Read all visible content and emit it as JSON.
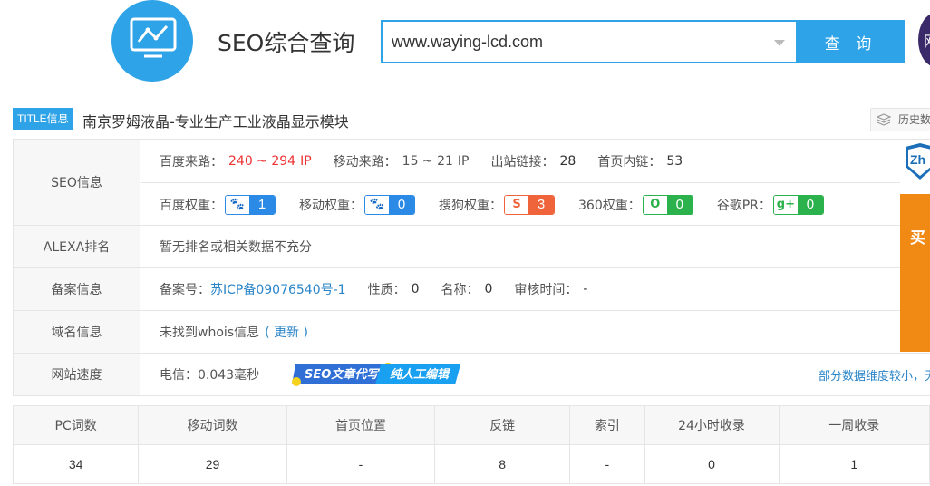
{
  "header": {
    "site_title": "SEO综合查询",
    "search_value": "www.waying-lcd.com",
    "search_button": "查 询",
    "avatar_text": "网"
  },
  "title_row": {
    "badge": "TITLE信息",
    "title": "南京罗姆液晶-专业生产工业液晶显示模块",
    "history_label": "历史数"
  },
  "seo_info": {
    "label": "SEO信息",
    "baidu_source_label": "百度来路：",
    "baidu_source_value": "240 ~ 294",
    "ip_unit": "IP",
    "mobile_source_label": "移动来路：",
    "mobile_source_value": "15 ~ 21",
    "outbound_links_label": "出站链接：",
    "outbound_links_value": "28",
    "home_internal_links_label": "首页内链：",
    "home_internal_links_value": "53",
    "weights": [
      {
        "label": "百度权重：",
        "icon": "🐾",
        "value": "1",
        "color": "#2a8ae6"
      },
      {
        "label": "移动权重：",
        "icon": "🐾",
        "value": "0",
        "color": "#2a8ae6"
      },
      {
        "label": "搜狗权重：",
        "icon": "S",
        "value": "3",
        "color": "#f0643c"
      },
      {
        "label": "360权重：",
        "icon": "O",
        "value": "0",
        "color": "#2bb24c"
      },
      {
        "label": "谷歌PR：",
        "icon": "g+",
        "value": "0",
        "color": "#2bb24c"
      }
    ]
  },
  "alexa": {
    "label": "ALEXA排名",
    "text": "暂无排名或相关数据不充分"
  },
  "beian": {
    "label": "备案信息",
    "number_label": "备案号：",
    "number_value": "苏ICP备09076540号-1",
    "nature_label": "性质：",
    "nature_value": "0",
    "name_label": "名称：",
    "name_value": "0",
    "review_label": "审核时间：",
    "review_value": "-"
  },
  "domain": {
    "label": "域名信息",
    "text": "未找到whois信息",
    "update_link": "( 更新 )"
  },
  "speed": {
    "label": "网站速度",
    "text": "电信：0.043毫秒",
    "banner_left": "SEO文章代写",
    "banner_right": "纯人工编辑",
    "right_note": "部分数据维度较小，无"
  },
  "side_ad": {
    "logo_text": "Zh",
    "text": "买"
  },
  "stats": {
    "headers": [
      "PC词数",
      "移动词数",
      "首页位置",
      "反链",
      "索引",
      "24小时收录",
      "一周收录"
    ],
    "values": [
      "34",
      "29",
      "-",
      "8",
      "-",
      "0",
      "1"
    ]
  }
}
